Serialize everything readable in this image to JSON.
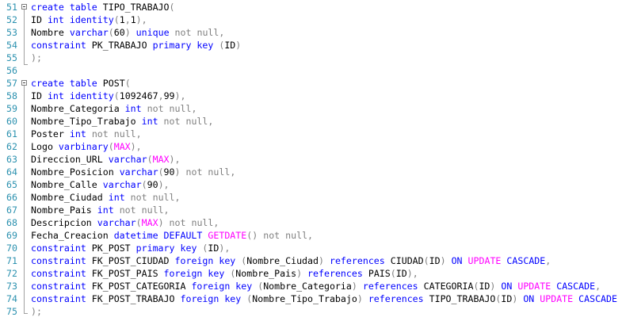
{
  "colors": {
    "keyword": "#0000ff",
    "operator": "#808080",
    "function": "#ff00ff",
    "identifier": "#000000",
    "line_number": "#2b91af"
  },
  "lines": [
    {
      "n": "51",
      "tokens": [
        [
          "kw",
          "create"
        ],
        [
          "plain",
          " "
        ],
        [
          "kw",
          "table"
        ],
        [
          "plain",
          " TIPO_TRABAJO"
        ],
        [
          "gray",
          "("
        ]
      ]
    },
    {
      "n": "52",
      "tokens": [
        [
          "plain",
          "ID "
        ],
        [
          "kw",
          "int"
        ],
        [
          "plain",
          " "
        ],
        [
          "kw",
          "identity"
        ],
        [
          "gray",
          "("
        ],
        [
          "plain",
          "1"
        ],
        [
          "gray",
          ","
        ],
        [
          "plain",
          "1"
        ],
        [
          "gray",
          "),"
        ]
      ]
    },
    {
      "n": "53",
      "tokens": [
        [
          "plain",
          "Nombre "
        ],
        [
          "kw",
          "varchar"
        ],
        [
          "gray",
          "("
        ],
        [
          "plain",
          "60"
        ],
        [
          "gray",
          ")"
        ],
        [
          "plain",
          " "
        ],
        [
          "kw",
          "unique"
        ],
        [
          "plain",
          " "
        ],
        [
          "gray",
          "not null,"
        ]
      ]
    },
    {
      "n": "54",
      "tokens": [
        [
          "kw",
          "constraint"
        ],
        [
          "plain",
          " PK_TRABAJO "
        ],
        [
          "kw",
          "primary key"
        ],
        [
          "plain",
          " "
        ],
        [
          "gray",
          "("
        ],
        [
          "plain",
          "ID"
        ],
        [
          "gray",
          ")"
        ]
      ]
    },
    {
      "n": "55",
      "tokens": [
        [
          "gray",
          ");"
        ]
      ]
    },
    {
      "n": "56",
      "tokens": []
    },
    {
      "n": "57",
      "tokens": [
        [
          "kw",
          "create"
        ],
        [
          "plain",
          " "
        ],
        [
          "kw",
          "table"
        ],
        [
          "plain",
          " POST"
        ],
        [
          "gray",
          "("
        ]
      ]
    },
    {
      "n": "58",
      "tokens": [
        [
          "plain",
          "ID "
        ],
        [
          "kw",
          "int"
        ],
        [
          "plain",
          " "
        ],
        [
          "kw",
          "identity"
        ],
        [
          "gray",
          "("
        ],
        [
          "plain",
          "1092467"
        ],
        [
          "gray",
          ","
        ],
        [
          "plain",
          "99"
        ],
        [
          "gray",
          "),"
        ]
      ]
    },
    {
      "n": "59",
      "tokens": [
        [
          "plain",
          "Nombre_Categoria "
        ],
        [
          "kw",
          "int"
        ],
        [
          "plain",
          " "
        ],
        [
          "gray",
          "not null,"
        ]
      ]
    },
    {
      "n": "60",
      "tokens": [
        [
          "plain",
          "Nombre_Tipo_Trabajo "
        ],
        [
          "kw",
          "int"
        ],
        [
          "plain",
          " "
        ],
        [
          "gray",
          "not null,"
        ]
      ]
    },
    {
      "n": "61",
      "tokens": [
        [
          "plain",
          "Poster "
        ],
        [
          "kw",
          "int"
        ],
        [
          "plain",
          " "
        ],
        [
          "gray",
          "not null,"
        ]
      ]
    },
    {
      "n": "62",
      "tokens": [
        [
          "plain",
          "Logo "
        ],
        [
          "kw",
          "varbinary"
        ],
        [
          "gray",
          "("
        ],
        [
          "fn",
          "MAX"
        ],
        [
          "gray",
          "),"
        ]
      ]
    },
    {
      "n": "63",
      "tokens": [
        [
          "plain",
          "Direccion_URL "
        ],
        [
          "kw",
          "varchar"
        ],
        [
          "gray",
          "("
        ],
        [
          "fn",
          "MAX"
        ],
        [
          "gray",
          "),"
        ]
      ]
    },
    {
      "n": "64",
      "tokens": [
        [
          "plain",
          "Nombre_Posicion "
        ],
        [
          "kw",
          "varchar"
        ],
        [
          "gray",
          "("
        ],
        [
          "plain",
          "90"
        ],
        [
          "gray",
          ")"
        ],
        [
          "plain",
          " "
        ],
        [
          "gray",
          "not null,"
        ]
      ]
    },
    {
      "n": "65",
      "tokens": [
        [
          "plain",
          "Nombre_Calle "
        ],
        [
          "kw",
          "varchar"
        ],
        [
          "gray",
          "("
        ],
        [
          "plain",
          "90"
        ],
        [
          "gray",
          "),"
        ]
      ]
    },
    {
      "n": "66",
      "tokens": [
        [
          "plain",
          "Nombre_Ciudad "
        ],
        [
          "kw",
          "int"
        ],
        [
          "plain",
          " "
        ],
        [
          "gray",
          "not null,"
        ]
      ]
    },
    {
      "n": "67",
      "tokens": [
        [
          "plain",
          "Nombre_Pais "
        ],
        [
          "kw",
          "int"
        ],
        [
          "plain",
          " "
        ],
        [
          "gray",
          "not null,"
        ]
      ]
    },
    {
      "n": "68",
      "tokens": [
        [
          "plain",
          "Descripcion "
        ],
        [
          "kw",
          "varchar"
        ],
        [
          "gray",
          "("
        ],
        [
          "fn",
          "MAX"
        ],
        [
          "gray",
          ")"
        ],
        [
          "plain",
          " "
        ],
        [
          "gray",
          "not null,"
        ]
      ]
    },
    {
      "n": "69",
      "tokens": [
        [
          "plain",
          "Fecha_Creacion "
        ],
        [
          "kw",
          "datetime"
        ],
        [
          "plain",
          " "
        ],
        [
          "kw",
          "DEFAULT"
        ],
        [
          "plain",
          " "
        ],
        [
          "fn",
          "GETDATE"
        ],
        [
          "gray",
          "()"
        ],
        [
          "plain",
          " "
        ],
        [
          "gray",
          "not null,"
        ]
      ]
    },
    {
      "n": "70",
      "tokens": [
        [
          "kw",
          "constraint"
        ],
        [
          "plain",
          " PK_POST "
        ],
        [
          "kw",
          "primary key"
        ],
        [
          "plain",
          " "
        ],
        [
          "gray",
          "("
        ],
        [
          "plain",
          "ID"
        ],
        [
          "gray",
          "),"
        ]
      ]
    },
    {
      "n": "71",
      "tokens": [
        [
          "kw",
          "constraint"
        ],
        [
          "plain",
          " FK_POST_CIUDAD "
        ],
        [
          "kw",
          "foreign key"
        ],
        [
          "plain",
          " "
        ],
        [
          "gray",
          "("
        ],
        [
          "plain",
          "Nombre_Ciudad"
        ],
        [
          "gray",
          ")"
        ],
        [
          "plain",
          " "
        ],
        [
          "kw",
          "references"
        ],
        [
          "plain",
          " CIUDAD"
        ],
        [
          "gray",
          "("
        ],
        [
          "plain",
          "ID"
        ],
        [
          "gray",
          ")"
        ],
        [
          "plain",
          " "
        ],
        [
          "kw",
          "ON"
        ],
        [
          "plain",
          " "
        ],
        [
          "fn",
          "UPDATE"
        ],
        [
          "plain",
          " "
        ],
        [
          "kw",
          "CASCADE"
        ],
        [
          "gray",
          ","
        ]
      ]
    },
    {
      "n": "72",
      "tokens": [
        [
          "kw",
          "constraint"
        ],
        [
          "plain",
          " FK_POST_PAIS "
        ],
        [
          "kw",
          "foreign key"
        ],
        [
          "plain",
          " "
        ],
        [
          "gray",
          "("
        ],
        [
          "plain",
          "Nombre_Pais"
        ],
        [
          "gray",
          ")"
        ],
        [
          "plain",
          " "
        ],
        [
          "kw",
          "references"
        ],
        [
          "plain",
          " PAIS"
        ],
        [
          "gray",
          "("
        ],
        [
          "plain",
          "ID"
        ],
        [
          "gray",
          "),"
        ]
      ]
    },
    {
      "n": "73",
      "tokens": [
        [
          "kw",
          "constraint"
        ],
        [
          "plain",
          " FK_POST_CATEGORIA "
        ],
        [
          "kw",
          "foreign key"
        ],
        [
          "plain",
          " "
        ],
        [
          "gray",
          "("
        ],
        [
          "plain",
          "Nombre_Categoria"
        ],
        [
          "gray",
          ")"
        ],
        [
          "plain",
          " "
        ],
        [
          "kw",
          "references"
        ],
        [
          "plain",
          " CATEGORIA"
        ],
        [
          "gray",
          "("
        ],
        [
          "plain",
          "ID"
        ],
        [
          "gray",
          ")"
        ],
        [
          "plain",
          " "
        ],
        [
          "kw",
          "ON"
        ],
        [
          "plain",
          " "
        ],
        [
          "fn",
          "UPDATE"
        ],
        [
          "plain",
          " "
        ],
        [
          "kw",
          "CASCADE"
        ],
        [
          "gray",
          ","
        ]
      ]
    },
    {
      "n": "74",
      "tokens": [
        [
          "kw",
          "constraint"
        ],
        [
          "plain",
          " FK_POST_TRABAJO "
        ],
        [
          "kw",
          "foreign key"
        ],
        [
          "plain",
          " "
        ],
        [
          "gray",
          "("
        ],
        [
          "plain",
          "Nombre_Tipo_Trabajo"
        ],
        [
          "gray",
          ")"
        ],
        [
          "plain",
          " "
        ],
        [
          "kw",
          "references"
        ],
        [
          "plain",
          " TIPO_TRABAJO"
        ],
        [
          "gray",
          "("
        ],
        [
          "plain",
          "ID"
        ],
        [
          "gray",
          ")"
        ],
        [
          "plain",
          " "
        ],
        [
          "kw",
          "ON"
        ],
        [
          "plain",
          " "
        ],
        [
          "fn",
          "UPDATE"
        ],
        [
          "plain",
          " "
        ],
        [
          "kw",
          "CASCADE"
        ]
      ]
    },
    {
      "n": "75",
      "tokens": [
        [
          "gray",
          ");"
        ]
      ]
    }
  ]
}
